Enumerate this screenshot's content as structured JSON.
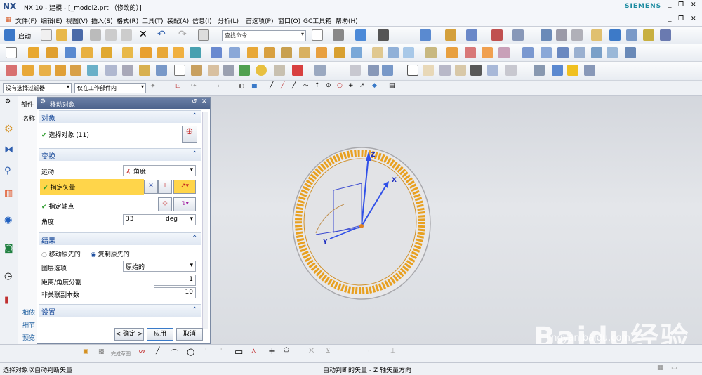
{
  "titlebar": {
    "logo": "NX",
    "title": "NX 10 - 建模 - [_model2.prt （修改的）]",
    "brand": "SIEMENS"
  },
  "menubar": {
    "items": [
      "文件(F)",
      "编辑(E)",
      "视图(V)",
      "插入(S)",
      "格式(R)",
      "工具(T)",
      "装配(A)",
      "信息(I)",
      "分析(L)",
      "首选项(P)",
      "窗口(O)",
      "GC工具箱",
      "帮助(H)"
    ]
  },
  "toolbar": {
    "start_label": "启动",
    "search_placeholder": "查找命令"
  },
  "selectionbar": {
    "filter": "没有选择过滤器",
    "scope": "仅在工作部件内"
  },
  "navpanel": {
    "header": "部件",
    "col_name": "名称",
    "links": [
      "相依",
      "细节",
      "预览"
    ]
  },
  "dialog": {
    "title": "移动对象",
    "object_section": "对象",
    "select_object": "选择对象 (11)",
    "transform_section": "变换",
    "motion_label": "运动",
    "motion_value": "角度",
    "vector_label": "指定矢量",
    "pivot_label": "指定轴点",
    "angle_label": "角度",
    "angle_value": "33",
    "angle_unit": "deg",
    "result_section": "结果",
    "move_original": "移动原先的",
    "copy_original": "复制原先的",
    "layer_label": "图层选项",
    "layer_value": "原始的",
    "distance_label": "距离/角度分割",
    "distance_value": "1",
    "copies_label": "非关联副本数",
    "copies_value": "10",
    "settings_section": "设置",
    "ok": "< 确定 >",
    "apply": "应用",
    "cancel": "取消"
  },
  "cmdbar": {
    "finish_sketch": "完成草图"
  },
  "status": {
    "left": "选择对象以自动判断矢量",
    "center": "自动判断的矢量 - Z 轴矢量方向"
  },
  "watermark": {
    "brand": "Baidu经验",
    "url": "jingyan.baidu.com"
  },
  "viewport": {
    "axis_labels": [
      "X",
      "Y",
      "Z"
    ]
  },
  "colors": {
    "accent": "#4d638c",
    "highlight": "#ffd54a",
    "part": "#e8a020"
  }
}
